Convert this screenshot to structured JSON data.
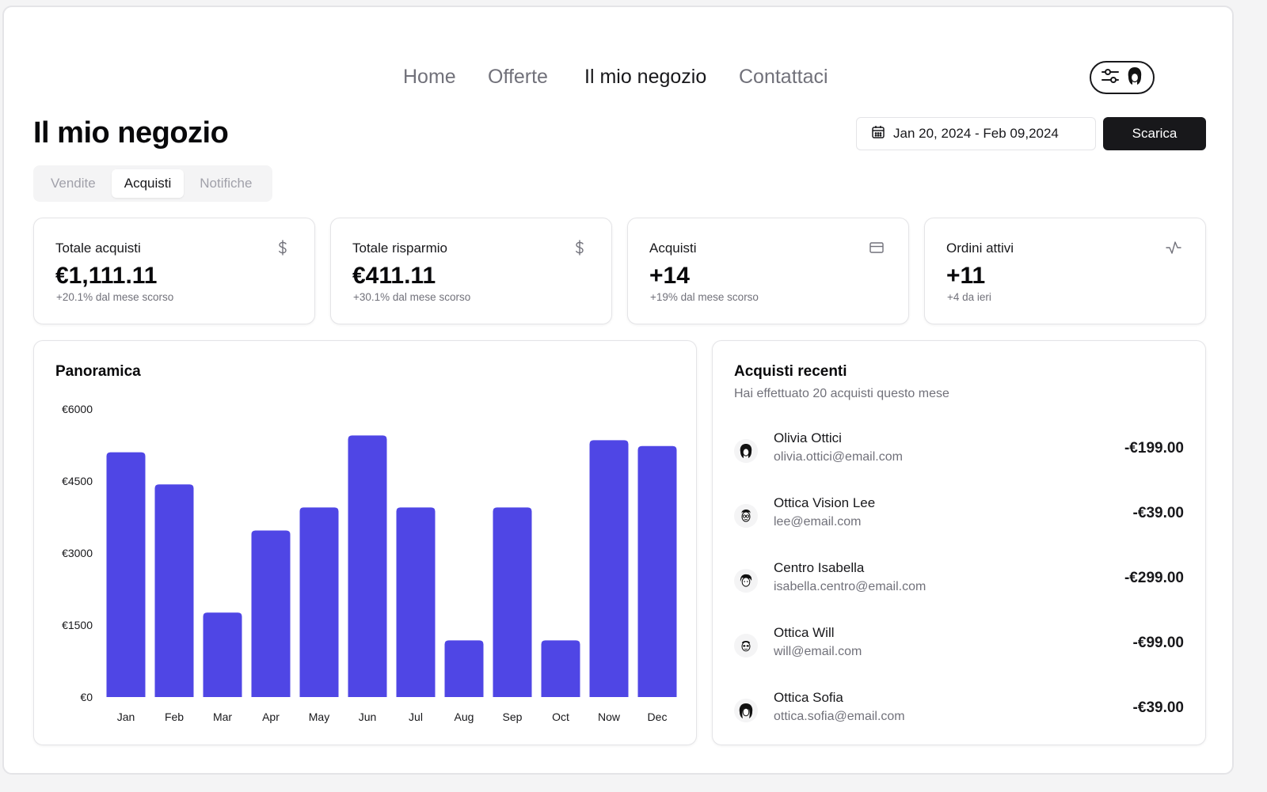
{
  "nav": {
    "items": [
      {
        "label": "Home",
        "active": false
      },
      {
        "label": "Offerte",
        "active": false
      },
      {
        "label": "Il mio negozio",
        "active": true
      },
      {
        "label": "Contattaci",
        "active": false
      }
    ]
  },
  "header": {
    "title": "Il mio negozio",
    "date_range": "Jan 20, 2024 - Feb 09,2024",
    "download_label": "Scarica"
  },
  "tabs": [
    {
      "label": "Vendite",
      "active": false
    },
    {
      "label": "Acquisti",
      "active": true
    },
    {
      "label": "Notifiche",
      "active": false
    }
  ],
  "stats": [
    {
      "title": "Totale acquisti",
      "value": "€1,111.11",
      "sub": "+20.1% dal mese scorso",
      "icon": "dollar-icon"
    },
    {
      "title": "Totale risparmio",
      "value": "€411.11",
      "sub": "+30.1% dal mese scorso",
      "icon": "dollar-icon"
    },
    {
      "title": "Acquisti",
      "value": "+14",
      "sub": "+19% dal mese scorso",
      "icon": "credit-card-icon"
    },
    {
      "title": "Ordini attivi",
      "value": "+11",
      "sub": "+4 da ieri",
      "icon": "activity-icon"
    }
  ],
  "overview": {
    "title": "Panoramica"
  },
  "chart_data": {
    "type": "bar",
    "categories": [
      "Jan",
      "Feb",
      "Mar",
      "Apr",
      "May",
      "Jun",
      "Jul",
      "Aug",
      "Sep",
      "Oct",
      "Now",
      "Dec"
    ],
    "values": [
      5100,
      4430,
      1760,
      3470,
      3950,
      5450,
      3950,
      1180,
      3950,
      1180,
      5350,
      5230
    ],
    "ylim": [
      0,
      6000
    ],
    "yticks": [
      0,
      1500,
      3000,
      4500,
      6000
    ],
    "ytick_labels": [
      "€0",
      "€1500",
      "€3000",
      "€4500",
      "€6000"
    ],
    "title": "Panoramica",
    "xlabel": "",
    "ylabel": "",
    "color": "#4f46e5",
    "grid": false
  },
  "recent": {
    "title": "Acquisti recenti",
    "subtitle": "Hai effettuato 20 acquisti questo mese",
    "items": [
      {
        "name": "Olivia Ottici",
        "email": "olivia.ottici@email.com",
        "amount": "-€199.00"
      },
      {
        "name": "Ottica Vision Lee",
        "email": "lee@email.com",
        "amount": "-€39.00"
      },
      {
        "name": "Centro Isabella",
        "email": "isabella.centro@email.com",
        "amount": "-€299.00"
      },
      {
        "name": "Ottica Will",
        "email": "will@email.com",
        "amount": "-€99.00"
      },
      {
        "name": "Ottica Sofia",
        "email": "ottica.sofia@email.com",
        "amount": "-€39.00"
      }
    ]
  }
}
